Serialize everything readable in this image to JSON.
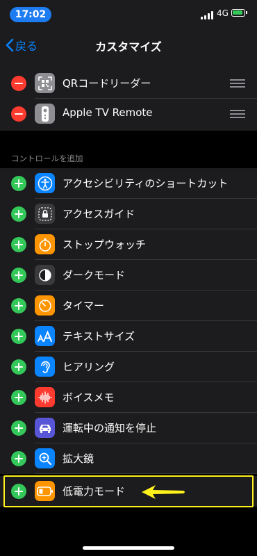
{
  "status_bar": {
    "time": "17:02",
    "network": "4G"
  },
  "nav": {
    "back_label": "戻る",
    "title": "カスタマイズ"
  },
  "included": [
    {
      "label": "QRコードリーダー",
      "icon": "qr-code-icon"
    },
    {
      "label": "Apple TV Remote",
      "icon": "apple-tv-remote-icon"
    }
  ],
  "more_controls": {
    "header": "コントロールを追加",
    "items": [
      {
        "label": "アクセシビリティのショートカット",
        "icon": "accessibility-icon",
        "color": "#0a84ff"
      },
      {
        "label": "アクセスガイド",
        "icon": "guided-access-icon",
        "color": "#3a3a3c"
      },
      {
        "label": "ストップウォッチ",
        "icon": "stopwatch-icon",
        "color": "#ff9500"
      },
      {
        "label": "ダークモード",
        "icon": "dark-mode-icon",
        "color": "#3a3a3c"
      },
      {
        "label": "タイマー",
        "icon": "timer-icon",
        "color": "#ff9500"
      },
      {
        "label": "テキストサイズ",
        "icon": "text-size-icon",
        "color": "#0a84ff"
      },
      {
        "label": "ヒアリング",
        "icon": "hearing-icon",
        "color": "#0a84ff"
      },
      {
        "label": "ボイスメモ",
        "icon": "voice-memos-icon",
        "color": "#ff3b30"
      },
      {
        "label": "運転中の通知を停止",
        "icon": "car-icon",
        "color": "#5856d6"
      },
      {
        "label": "拡大鏡",
        "icon": "magnifier-icon",
        "color": "#0a84ff"
      },
      {
        "label": "低電力モード",
        "icon": "battery-icon",
        "color": "#ff9500"
      }
    ]
  },
  "colors": {
    "accent": "#0a84ff",
    "add": "#34c759",
    "remove": "#ff3b30",
    "highlight": "#fff21c"
  }
}
